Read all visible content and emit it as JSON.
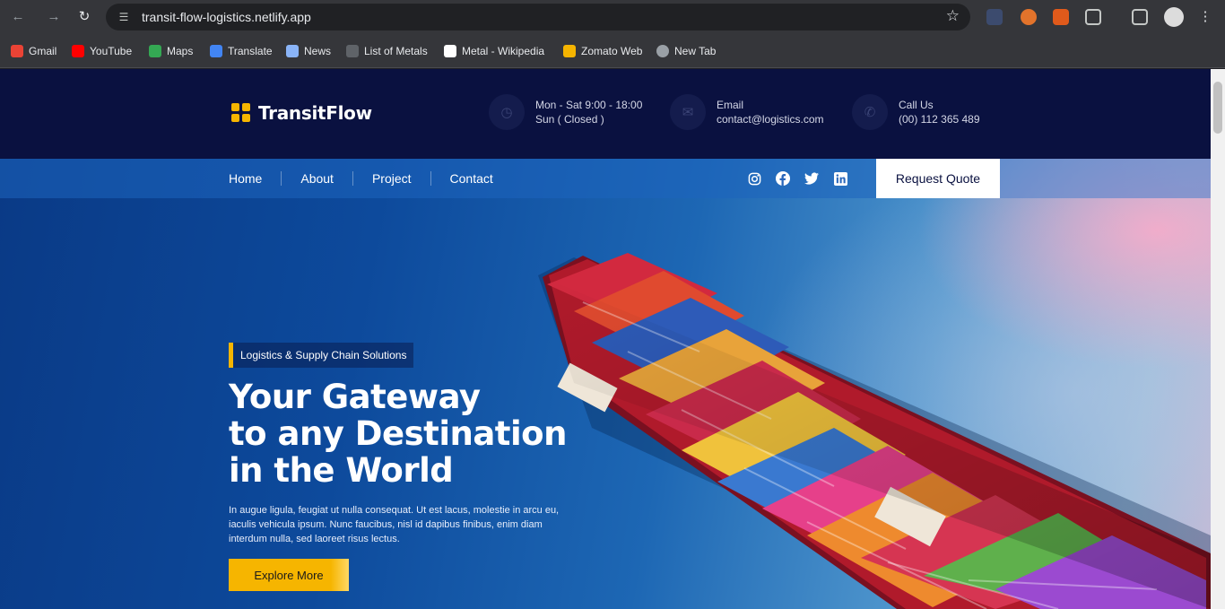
{
  "browser": {
    "url": "transit-flow-logistics.netlify.app",
    "bookmarks": [
      {
        "label": "Gmail",
        "color": "#ea4335"
      },
      {
        "label": "YouTube",
        "color": "#ff0000"
      },
      {
        "label": "Maps",
        "color": "#34a853"
      },
      {
        "label": "Translate",
        "color": "#4285f4"
      },
      {
        "label": "News",
        "color": "#8ab4f8"
      },
      {
        "label": "List of Metals",
        "color": "#5f6368"
      },
      {
        "label": "Metal - Wikipedia",
        "color": "#ffffff"
      },
      {
        "label": "Zomato Web",
        "color": "#f5b400"
      },
      {
        "label": "New Tab",
        "color": "#9aa0a6"
      }
    ]
  },
  "site": {
    "brand": "TransitFlow",
    "accent": "#f6b500",
    "header_bg": "#0a1140",
    "info": {
      "hours_line1": "Mon - Sat 9:00 - 18:00",
      "hours_line2": "Sun ( Closed )",
      "email_label": "Email",
      "email": "contact@logistics.com",
      "call_label": "Call Us",
      "phone": "(00) 112 365 489"
    },
    "nav": {
      "home": "Home",
      "about": "About",
      "project": "Project",
      "contact": "Contact",
      "quote": "Request Quote"
    },
    "social_icons": [
      "instagram-icon",
      "facebook-icon",
      "twitter-icon",
      "linkedin-icon"
    ],
    "hero": {
      "tagline": "Logistics & Supply Chain Solutions",
      "headline_line1": "Your Gateway",
      "headline_line2": "to any Destination",
      "headline_line3": "in the World",
      "description": "In augue ligula, feugiat ut nulla consequat. Ut est lacus, molestie in arcu eu, iaculis vehicula ipsum. Nunc faucibus, nisl id dapibus finibus, enim diam interdum nulla, sed laoreet risus lectus.",
      "button": "Explore More"
    }
  }
}
